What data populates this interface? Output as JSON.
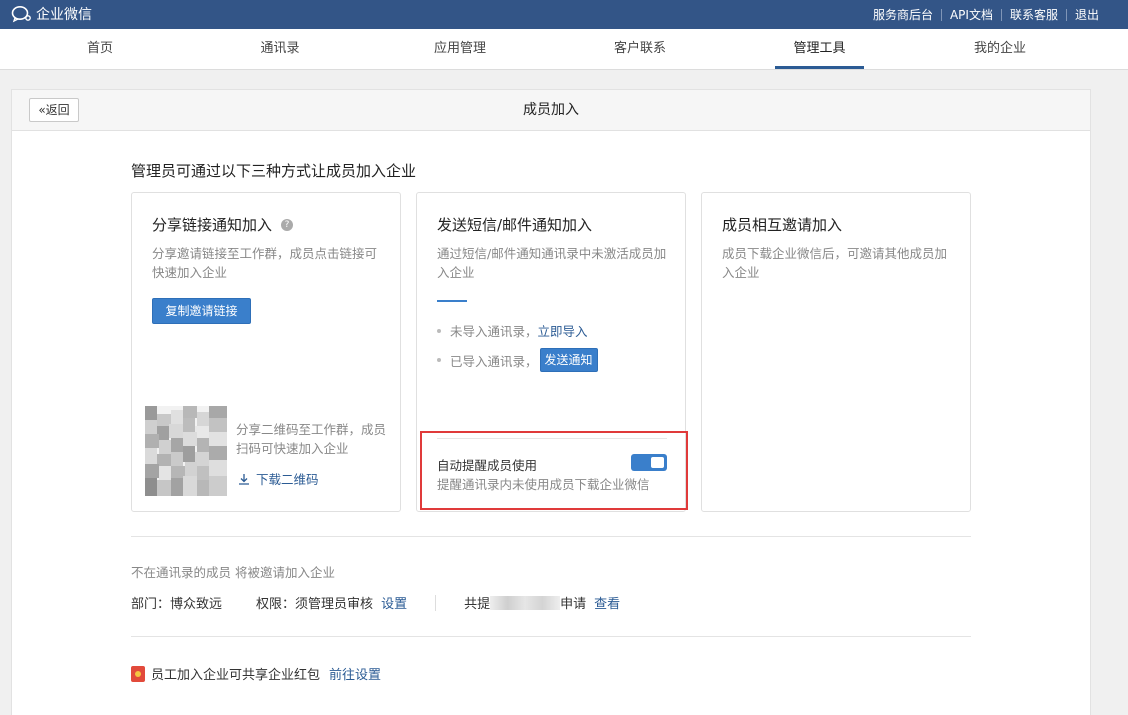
{
  "header": {
    "logo_text": "企业微信",
    "links": [
      "服务商后台",
      "API文档",
      "联系客服",
      "退出"
    ]
  },
  "nav": {
    "items": [
      "首页",
      "通讯录",
      "应用管理",
      "客户联系",
      "管理工具",
      "我的企业"
    ],
    "active": "管理工具"
  },
  "page": {
    "back_label": "«返回",
    "title": "成员加入",
    "intro": "管理员可通过以下三种方式让成员加入企业"
  },
  "cards": [
    {
      "title": "分享链接通知加入",
      "help_icon": "question-icon",
      "desc": "分享邀请链接至工作群，成员点击链接可快速加入企业",
      "button": "复制邀请链接",
      "qr_text": "分享二维码至工作群，成员扫码可快速加入企业",
      "qr_download": "下载二维码"
    },
    {
      "title": "发送短信/邮件通知加入",
      "desc": "通过短信/邮件通知通讯录中未激活成员加入企业",
      "bullet1_text": "未导入通讯录，",
      "bullet1_link": "立即导入",
      "bullet2_text": "已导入通讯录，",
      "bullet2_button": "发送通知",
      "remind_title": "自动提醒成员使用",
      "remind_desc": "提醒通讯录内未使用成员下载企业微信",
      "remind_on": true
    },
    {
      "title": "成员相互邀请加入",
      "desc": "成员下载企业微信后，可邀请其他成员加入企业"
    }
  ],
  "join_info": {
    "note": "不在通讯录的成员 将被邀请加入企业",
    "dept_label": "部门：",
    "dept_value": "博众致远",
    "perm_label": "权限：",
    "perm_value": "须管理员审核",
    "perm_link": "设置",
    "apply_prefix": "共提",
    "apply_suffix": "申请",
    "apply_link": "查看"
  },
  "redpacket": {
    "text": "员工加入企业可共享企业红包",
    "link": "前往设置"
  },
  "colors": {
    "topbar": "#335587",
    "accent": "#3a7fcb",
    "highlight": "#e03a3a"
  }
}
